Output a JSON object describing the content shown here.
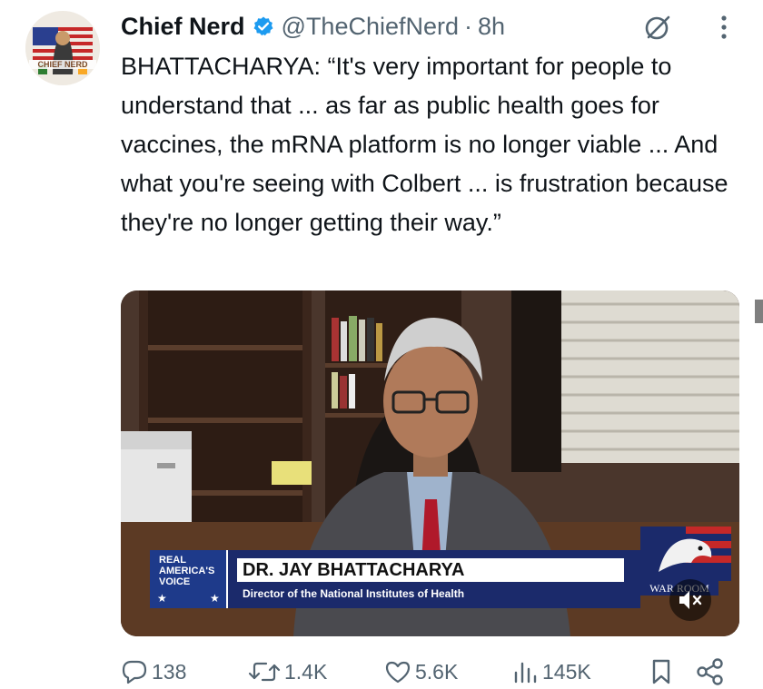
{
  "tweet": {
    "author_name": "Chief Nerd",
    "handle": "@TheChiefNerd",
    "separator": "·",
    "time": "8h",
    "avatar_text": "CHIEF NERD",
    "text": "BHATTACHARYA: “It's very important for people to understand that ... as far as public health goes for vaccines, the mRNA platform is no longer viable ... And what you're seeing with Colbert ... is frustration because they're no longer getting their way.”"
  },
  "video": {
    "network_line1": "REAL",
    "network_line2": "AMERICA'S",
    "network_line3": "VOICE",
    "guest_name": "DR. JAY BHATTACHARYA",
    "guest_title": "Director of the National Institutes of Health",
    "show_logo": "WAR ROOM"
  },
  "actions": {
    "replies": "138",
    "reposts": "1.4K",
    "likes": "5.6K",
    "views": "145K"
  },
  "colors": {
    "verified": "#1d9bf0",
    "secondary_text": "#536471",
    "lower_third_blue": "#1b2a6b"
  }
}
